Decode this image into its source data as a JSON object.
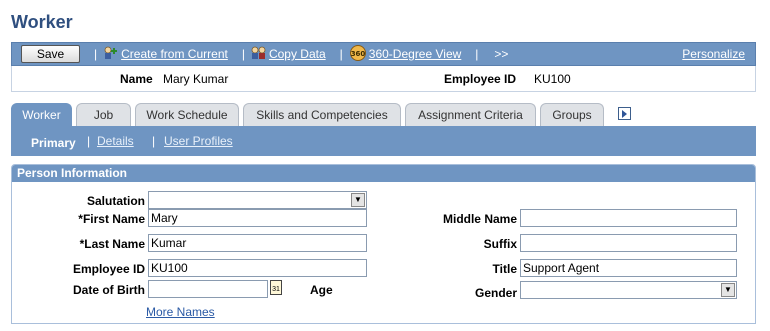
{
  "page": {
    "title": "Worker"
  },
  "toolbar": {
    "save_label": "Save",
    "create_label": "Create from Current",
    "copy_label": "Copy Data",
    "degree_label": "360-Degree View",
    "more_label": ">>",
    "personalize_label": "Personalize",
    "separator": "|"
  },
  "header": {
    "name_label": "Name",
    "name_value": "Mary Kumar",
    "empid_label": "Employee ID",
    "empid_value": "KU100"
  },
  "tabs": [
    {
      "label": "Worker",
      "active": true
    },
    {
      "label": "Job",
      "active": false
    },
    {
      "label": "Work Schedule",
      "active": false
    },
    {
      "label": "Skills and Competencies",
      "active": false
    },
    {
      "label": "Assignment Criteria",
      "active": false
    },
    {
      "label": "Groups",
      "active": false
    }
  ],
  "subtabs": {
    "primary_label": "Primary",
    "details_label": "Details",
    "profiles_label": "User Profiles",
    "separator": "|"
  },
  "person": {
    "section_title": "Person Information",
    "salutation_label": "Salutation",
    "salutation_value": "",
    "first_name_label": "*First Name",
    "first_name_value": "Mary",
    "last_name_label": "*Last Name",
    "last_name_value": "Kumar",
    "empid_label": "Employee ID",
    "empid_value": "KU100",
    "dob_label": "Date of Birth",
    "dob_value": "",
    "age_label": "Age",
    "middle_name_label": "Middle Name",
    "middle_name_value": "",
    "suffix_label": "Suffix",
    "suffix_value": "",
    "title_label": "Title",
    "title_value": "Support Agent",
    "gender_label": "Gender",
    "gender_value": "",
    "more_names_label": "More Names",
    "calendar_text": "31"
  },
  "icons": {
    "dropdown": "▼",
    "arrow_right": "▶"
  }
}
